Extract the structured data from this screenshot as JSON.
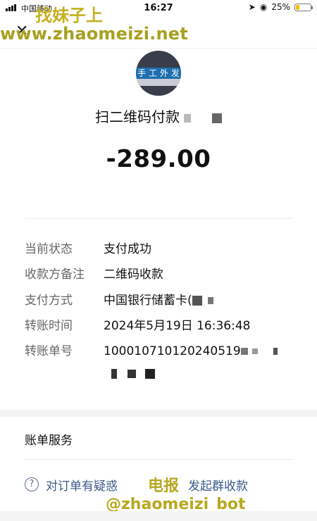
{
  "status_bar": {
    "carrier": "中国移动",
    "time": "16:27",
    "battery": "25%",
    "battery_level": 0.25
  },
  "watermark": {
    "top_text": "找妹子上",
    "url": "www.zhaomeizi.net",
    "dianbao": "电报",
    "bot": "@zhaomeizi_bot"
  },
  "transaction": {
    "title": "扫二维码付款",
    "amount": "-289.00"
  },
  "details": [
    {
      "label": "当前状态",
      "value": "支付成功"
    },
    {
      "label": "收款方备注",
      "value": "二维码收款"
    },
    {
      "label": "支付方式",
      "value": "中国银行储蓄卡("
    },
    {
      "label": "转账时间",
      "value": "2024年5月19日 16:36:48"
    },
    {
      "label": "转账单号",
      "value": "100010710120240519"
    }
  ],
  "services": {
    "title": "账单服务",
    "question": "对订单有疑惑",
    "group_collect": "发起群收款"
  }
}
